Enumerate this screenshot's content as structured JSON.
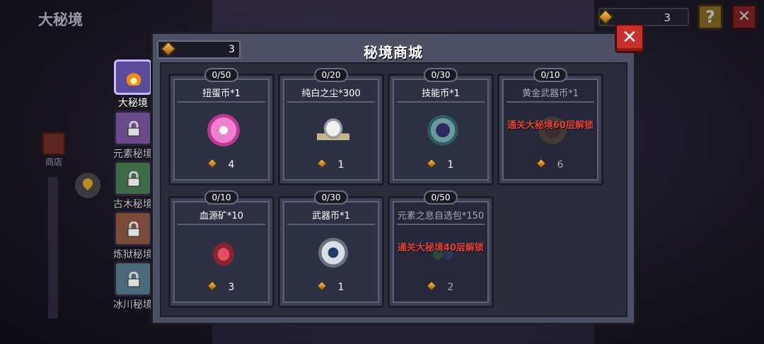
{
  "background": {
    "title": "大秘境"
  },
  "hud": {
    "gems": "3",
    "help_label": "?",
    "close_label": "✕"
  },
  "sidebar": {
    "shop_label": "商店",
    "tabs": [
      {
        "label": "大秘境",
        "active": true,
        "color": "#5a4a9a",
        "icon": "fire-icon"
      },
      {
        "label": "元素秘境",
        "locked": true,
        "color": "#6a4a8a",
        "icon": "lock-icon"
      },
      {
        "label": "古木秘境",
        "locked": true,
        "color": "#3f6a48",
        "icon": "lock-icon"
      },
      {
        "label": "炼狱秘境",
        "locked": true,
        "color": "#7a4a3a",
        "icon": "lock-icon"
      },
      {
        "label": "冰川秘境",
        "locked": true,
        "color": "#4a6a7a",
        "icon": "lock-icon"
      }
    ]
  },
  "modal": {
    "title": "秘境商城",
    "currency": "3",
    "close_label": "✕",
    "cards": [
      {
        "name": "扭蛋币*1",
        "limit": "0/50",
        "price": "4",
        "icon": "gacha-coin-icon"
      },
      {
        "name": "纯白之尘*300",
        "limit": "0/20",
        "price": "1",
        "icon": "white-dust-icon"
      },
      {
        "name": "技能币*1",
        "limit": "0/30",
        "price": "1",
        "icon": "skill-coin-icon"
      },
      {
        "name": "黄金武器币*1",
        "limit": "0/10",
        "price": "6",
        "icon": "gold-weapon-coin-icon",
        "locked": true,
        "lock_msg": "通关大秘境60层解锁"
      },
      {
        "name": "血源矿*10",
        "limit": "0/10",
        "price": "3",
        "icon": "blood-ore-icon"
      },
      {
        "name": "武器币*1",
        "limit": "0/30",
        "price": "1",
        "icon": "weapon-coin-icon"
      },
      {
        "name": "元素之息自选包*150",
        "limit": "0/50",
        "price": "2",
        "icon": "element-pack-icon",
        "locked": true,
        "lock_msg": "通关大秘境40层解锁"
      }
    ]
  },
  "colors": {
    "accent_gold": "#c98a2a",
    "close_red": "#c7302d",
    "lock_text": "#e0413a"
  }
}
